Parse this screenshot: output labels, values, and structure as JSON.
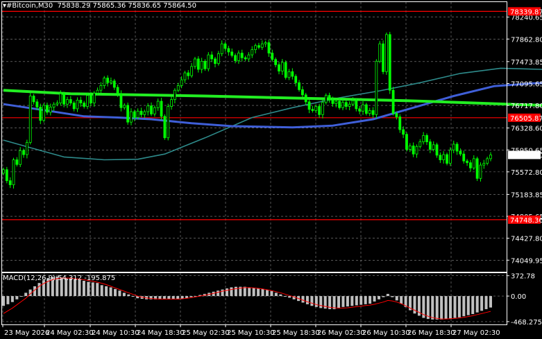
{
  "header": {
    "symbol": "#Bitcoin,M30",
    "ohlc": "75838.29 75865.36 75836.65 75864.50"
  },
  "macd": {
    "label": "MACD(12,26,9) 54.312 -195.875"
  },
  "price_axis": {
    "ticks": [
      "78240.65",
      "77862.80",
      "77473.85",
      "77095.65",
      "76717.80",
      "76328.60",
      "75950.65",
      "75572.80",
      "75183.85",
      "74805.65",
      "74427.80",
      "74049.95"
    ],
    "markers": [
      {
        "label": "78339.87",
        "kind": "red-box",
        "price": 78339.87
      },
      {
        "label": "76505.87",
        "kind": "red-box",
        "price": 76505.87
      },
      {
        "label": "75864.50",
        "kind": "white-box",
        "price": 75864.5
      },
      {
        "label": "74748.36",
        "kind": "red-box",
        "price": 74748.36
      }
    ]
  },
  "macd_axis": {
    "ticks": [
      "372.78",
      "0.00",
      "-468.275"
    ]
  },
  "time_axis": {
    "labels": [
      "23 May 2026",
      "24 May 02:30",
      "24 May 10:30",
      "24 May 18:30",
      "25 May 02:30",
      "25 May 10:30",
      "25 May 18:30",
      "26 May 02:30",
      "26 May 10:30",
      "26 May 18:30",
      "27 May 02:30"
    ]
  },
  "colors": {
    "background": "#000000",
    "grid": "#8c8c8c",
    "candle": "#00ff00",
    "ma_fast": "#2e8b8b",
    "ma_mid": "#3f5fd8",
    "ma_slow": "#22ee22",
    "level_line": "#ff0000",
    "macd_hist": "#c0c0c0",
    "macd_signal": "#ff0000"
  },
  "chart_data": {
    "type": "candlestick",
    "title": "#Bitcoin,M30",
    "ylim": [
      73850,
      78500
    ],
    "closes": [
      75610,
      75420,
      75350,
      75780,
      75700,
      75940,
      75870,
      76080,
      76880,
      76780,
      76690,
      76460,
      76720,
      76600,
      76690,
      76740,
      76760,
      76920,
      76740,
      76820,
      76760,
      76660,
      76810,
      76760,
      76700,
      76890,
      76760,
      76930,
      76980,
      77060,
      77190,
      77110,
      77140,
      77030,
      76920,
      76680,
      76720,
      76430,
      76610,
      76510,
      76620,
      76560,
      76610,
      76710,
      76570,
      76680,
      76790,
      76530,
      76160,
      76700,
      76820,
      76980,
      77060,
      77160,
      77280,
      77230,
      77390,
      77520,
      77340,
      77480,
      77350,
      77590,
      77520,
      77440,
      77610,
      77780,
      77700,
      77640,
      77580,
      77490,
      77620,
      77540,
      77520,
      77590,
      77680,
      77750,
      77720,
      77780,
      77800,
      77620,
      77510,
      77420,
      77310,
      77460,
      77200,
      77300,
      77220,
      77110,
      76990,
      76900,
      76780,
      76650,
      76630,
      76700,
      76560,
      76770,
      76890,
      76810,
      76750,
      76790,
      76680,
      76770,
      76700,
      76740,
      76800,
      76660,
      76620,
      76730,
      76580,
      76630,
      76560,
      77480,
      77780,
      77300,
      77940,
      76980,
      76580,
      76520,
      76300,
      76220,
      75960,
      76020,
      75880,
      76010,
      76090,
      76200,
      76090,
      75960,
      76040,
      75860,
      75780,
      75870,
      75720,
      75950,
      76050,
      75930,
      75880,
      75760,
      75730,
      75640,
      75800,
      75460,
      75690,
      75720,
      75800,
      75864.5
    ],
    "ma_slow_points": [
      [
        0,
        76980
      ],
      [
        20,
        76920
      ],
      [
        60,
        76880
      ],
      [
        120,
        76800
      ],
      [
        160,
        76720
      ],
      [
        200,
        76640
      ],
      [
        236,
        76520
      ],
      [
        246,
        76505
      ]
    ],
    "ma_mid_points": [
      [
        0,
        76740
      ],
      [
        14,
        76620
      ],
      [
        24,
        76530
      ],
      [
        34,
        76510
      ],
      [
        44,
        76480
      ],
      [
        56,
        76410
      ],
      [
        68,
        76360
      ],
      [
        86,
        76340
      ],
      [
        98,
        76370
      ],
      [
        110,
        76480
      ],
      [
        122,
        76680
      ],
      [
        134,
        76880
      ],
      [
        146,
        77050
      ],
      [
        158,
        77100
      ],
      [
        176,
        77110
      ],
      [
        194,
        77120
      ],
      [
        204,
        77080
      ],
      [
        214,
        77040
      ],
      [
        226,
        76960
      ],
      [
        238,
        76860
      ],
      [
        246,
        76780
      ]
    ],
    "ma_fast_points": [
      [
        0,
        76120
      ],
      [
        8,
        75990
      ],
      [
        18,
        75830
      ],
      [
        30,
        75780
      ],
      [
        40,
        75790
      ],
      [
        48,
        75880
      ],
      [
        60,
        76160
      ],
      [
        74,
        76510
      ],
      [
        86,
        76680
      ],
      [
        100,
        76850
      ],
      [
        112,
        76970
      ],
      [
        124,
        77110
      ],
      [
        136,
        77270
      ],
      [
        148,
        77360
      ],
      [
        160,
        77340
      ],
      [
        172,
        77250
      ],
      [
        186,
        77170
      ],
      [
        198,
        77120
      ],
      [
        208,
        77080
      ],
      [
        216,
        77050
      ],
      [
        226,
        76850
      ],
      [
        236,
        76600
      ],
      [
        246,
        76380
      ]
    ],
    "levels": [
      78339.87,
      76505.87,
      74748.36
    ],
    "macd_hist": [
      -180,
      -150,
      -110,
      -60,
      -10,
      60,
      120,
      180,
      240,
      290,
      330,
      350,
      360,
      340,
      330,
      330,
      310,
      300,
      280,
      260,
      250,
      240,
      200,
      180,
      160,
      130,
      100,
      60,
      30,
      -10,
      -40,
      -50,
      -60,
      -60,
      -60,
      -60,
      -60,
      -60,
      -60,
      -60,
      -50,
      -40,
      -20,
      0,
      20,
      40,
      60,
      80,
      100,
      120,
      140,
      160,
      170,
      170,
      170,
      160,
      150,
      140,
      130,
      110,
      90,
      60,
      30,
      0,
      -30,
      -60,
      -90,
      -120,
      -150,
      -180,
      -200,
      -220,
      -230,
      -240,
      -240,
      -220,
      -200,
      -190,
      -180,
      -170,
      -160,
      -150,
      -140,
      -100,
      -60,
      -20,
      40,
      -20,
      -80,
      -140,
      -200,
      -260,
      -320,
      -360,
      -400,
      -420,
      -430,
      -430,
      -430,
      -420,
      -410,
      -400,
      -390,
      -370,
      -350,
      -330,
      -300,
      -270,
      -240,
      -210
    ],
    "macd_signal": [
      -320,
      -270,
      -220,
      -160,
      -100,
      -40,
      40,
      110,
      180,
      230,
      270,
      300,
      320,
      330,
      330,
      330,
      320,
      310,
      300,
      285,
      270,
      255,
      235,
      210,
      180,
      150,
      120,
      90,
      60,
      30,
      0,
      -20,
      -35,
      -45,
      -50,
      -55,
      -55,
      -55,
      -55,
      -55,
      -50,
      -40,
      -30,
      -15,
      0,
      15,
      30,
      50,
      70,
      90,
      105,
      120,
      135,
      145,
      155,
      155,
      150,
      140,
      130,
      115,
      100,
      80,
      60,
      35,
      10,
      -15,
      -45,
      -75,
      -105,
      -130,
      -155,
      -175,
      -190,
      -205,
      -215,
      -220,
      -220,
      -215,
      -205,
      -195,
      -185,
      -175,
      -165,
      -150,
      -130,
      -110,
      -80,
      -90,
      -110,
      -140,
      -180,
      -220,
      -260,
      -300,
      -340,
      -370,
      -395,
      -410,
      -420,
      -420,
      -415,
      -410,
      -400,
      -390,
      -375,
      -360,
      -340,
      -320,
      -300,
      -280
    ]
  }
}
